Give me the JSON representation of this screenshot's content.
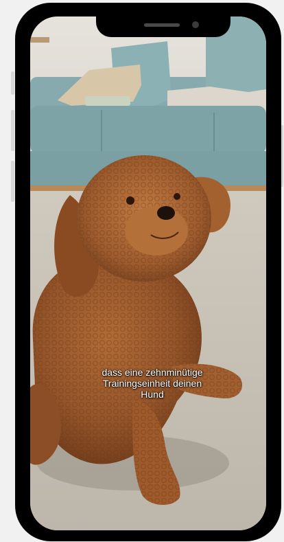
{
  "video": {
    "caption_lines": [
      "dass eine zehnminütige",
      "Trainingseinheit deinen",
      "Hund"
    ],
    "scene": "poodle-puppy-on-carpet-in-living-room"
  },
  "colors": {
    "frame": "#000000",
    "background": "#f1f1f1",
    "caption_text": "#ffffff",
    "sofa": "#8fb3b5",
    "carpet": "#c9c2b6",
    "dog_fur": "#9a5a2e"
  }
}
